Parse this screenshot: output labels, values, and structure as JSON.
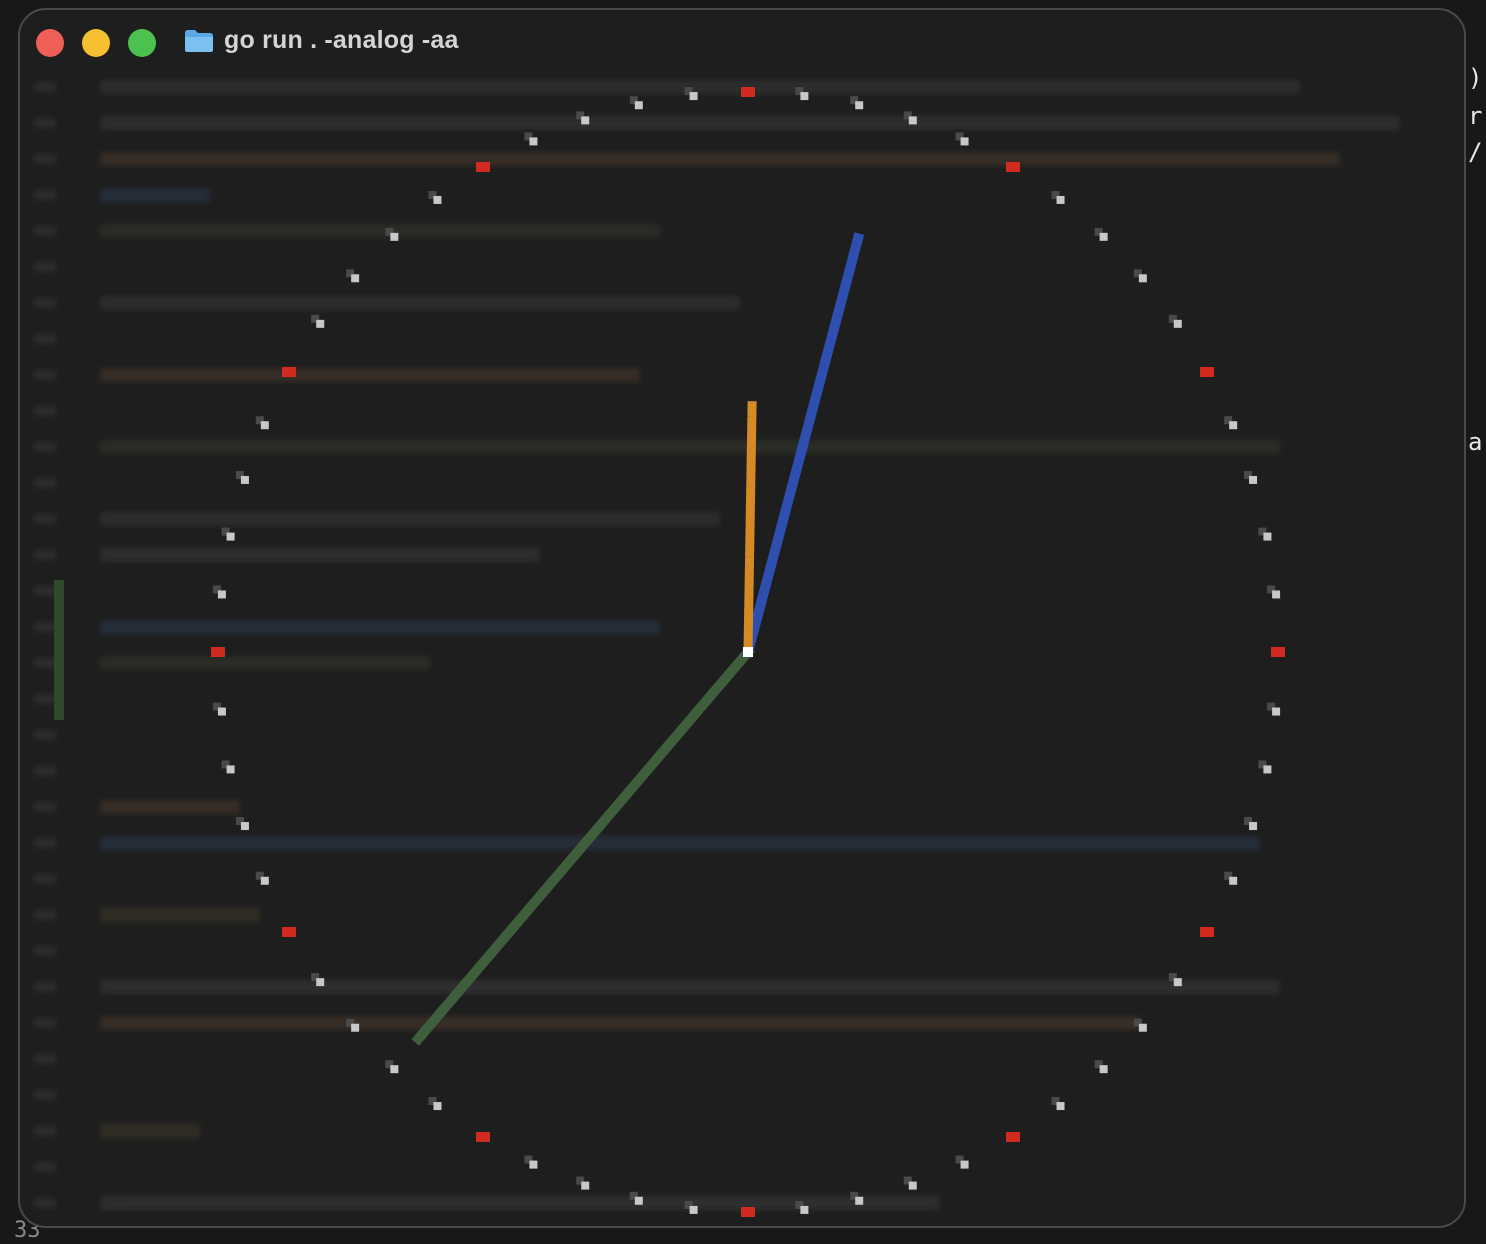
{
  "window": {
    "title": "go run . -analog -aa",
    "title_icon": "folder-icon",
    "buttons": [
      {
        "name": "close",
        "color": "#ee5f57"
      },
      {
        "name": "minimize",
        "color": "#f5bf2f"
      },
      {
        "name": "zoom",
        "color": "#4bc14f"
      }
    ]
  },
  "background_edge": {
    "chars": [
      ")",
      "r",
      "/",
      "a"
    ],
    "line_number": "33"
  },
  "clock": {
    "mode": "analog, anti-aliased",
    "time": {
      "hours": 12,
      "minutes": 2,
      "seconds": 37
    },
    "colors": {
      "hour_hand": "#d58a26",
      "minute_hand": "#2f4fb0",
      "second_hand": "#3f5f3c",
      "hour_tick": "#d12a20",
      "minute_tick": "#c8c8c8",
      "center": "#ffffff"
    }
  }
}
